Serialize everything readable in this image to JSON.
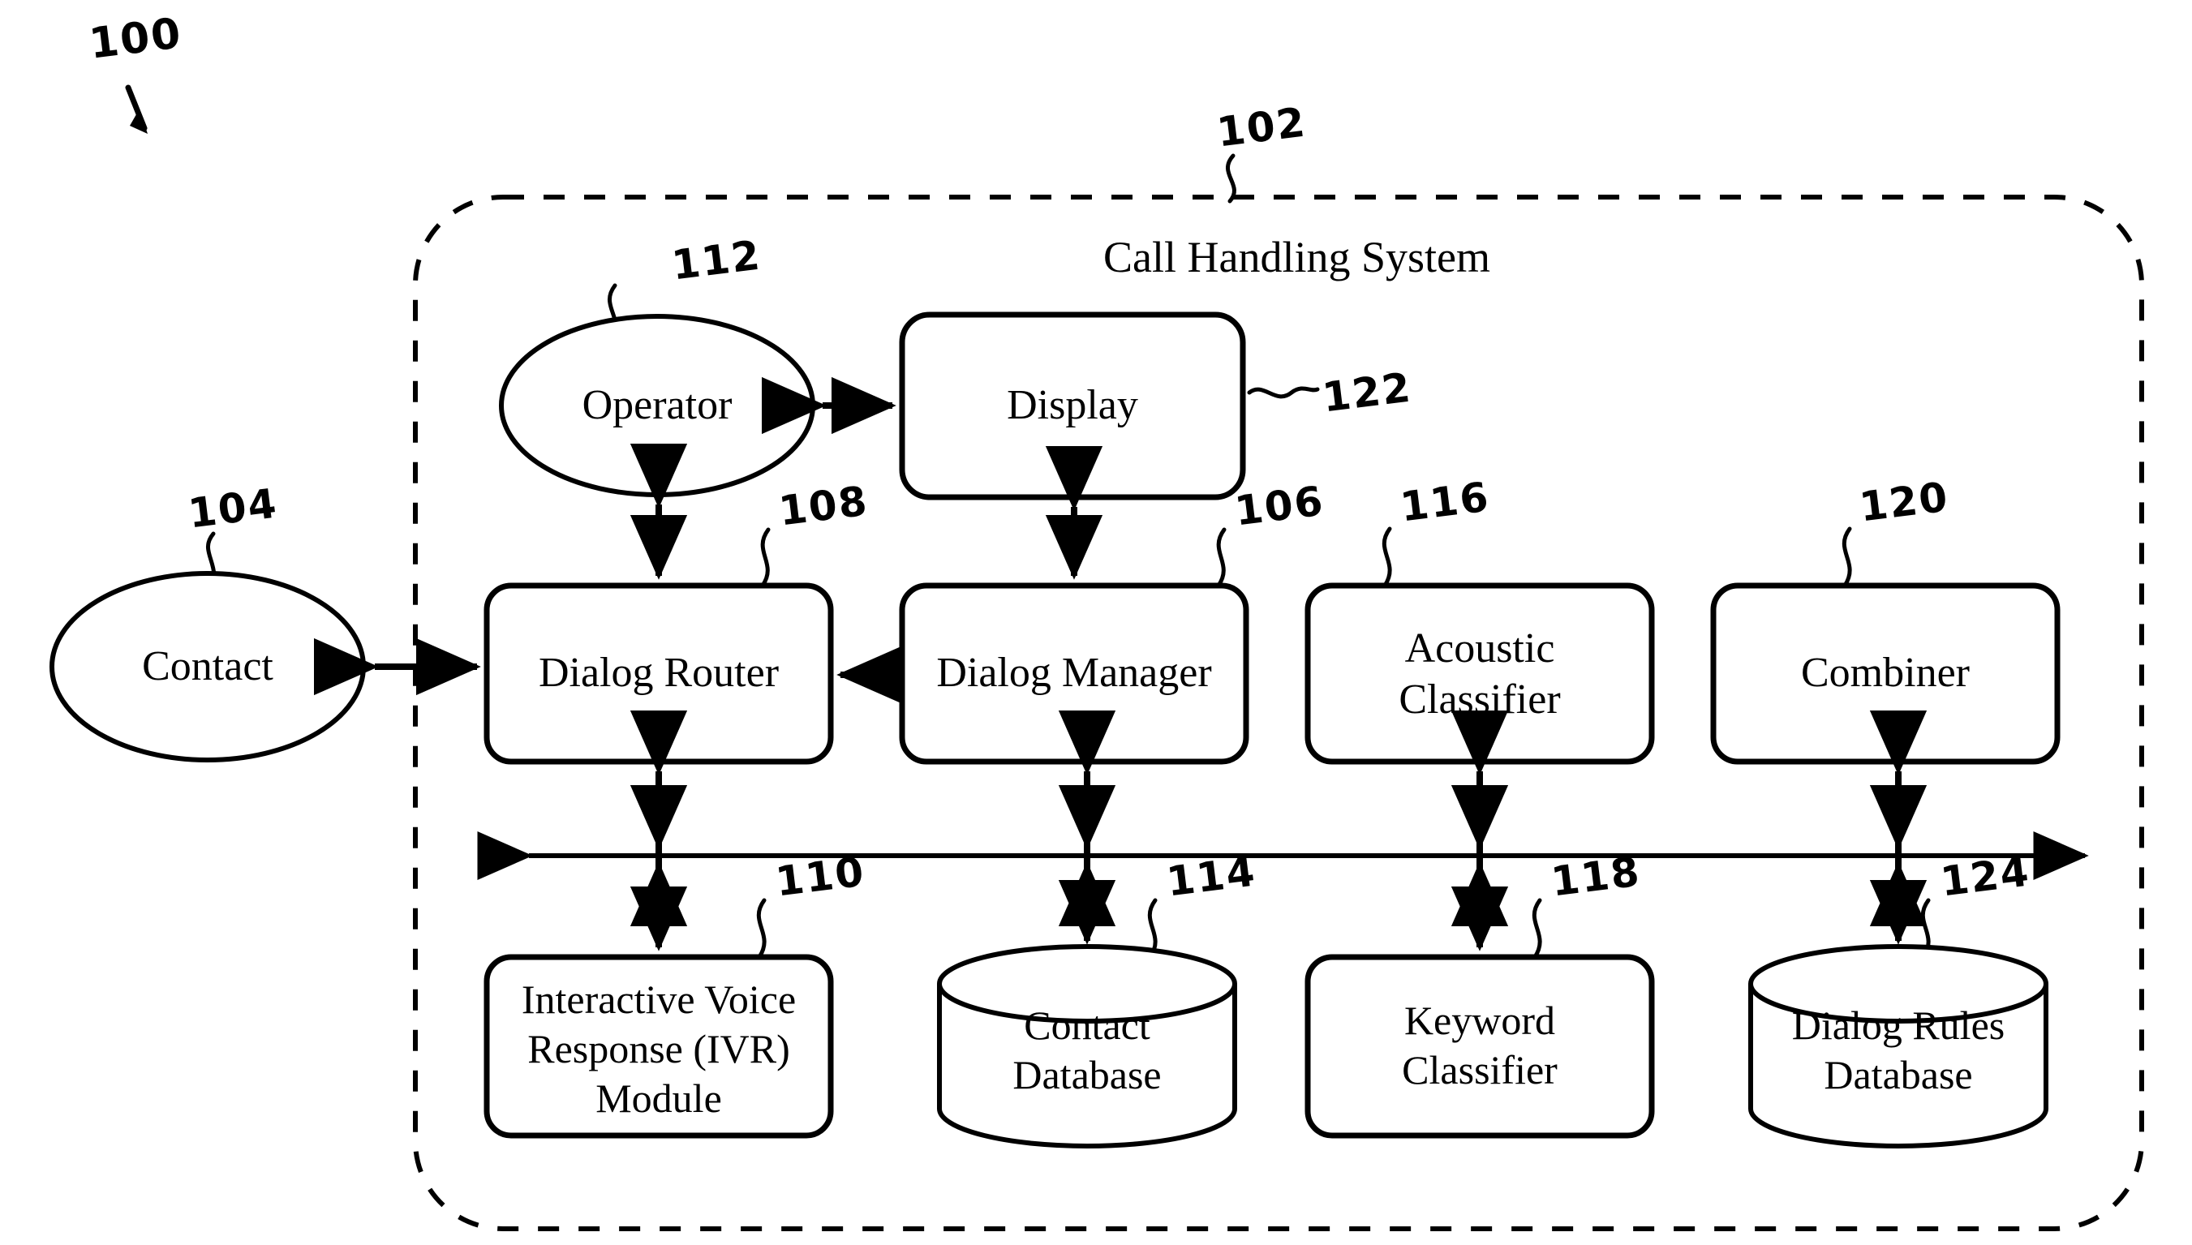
{
  "figure": {
    "figure_ref": "100",
    "system_ref": "102",
    "system_title": "Call Handling System"
  },
  "external": {
    "contact": {
      "label": "Contact",
      "ref": "104"
    }
  },
  "nodes": [
    {
      "id": "operator",
      "label": "Operator",
      "ref": "112",
      "shape": "ellipse"
    },
    {
      "id": "display",
      "label": "Display",
      "ref": "122",
      "shape": "rounded-rect"
    },
    {
      "id": "dialog-router",
      "label": "Dialog Router",
      "ref": "108",
      "shape": "rounded-rect"
    },
    {
      "id": "dialog-manager",
      "label": "Dialog Manager",
      "ref": "106",
      "shape": "rounded-rect"
    },
    {
      "id": "acoustic-classifier",
      "label": "Acoustic\nClassifier",
      "ref": "116",
      "shape": "rounded-rect"
    },
    {
      "id": "combiner",
      "label": "Combiner",
      "ref": "120",
      "shape": "rounded-rect"
    },
    {
      "id": "ivr-module",
      "label": "Interactive Voice\nResponse (IVR)\nModule",
      "ref": "110",
      "shape": "rounded-rect"
    },
    {
      "id": "contact-database",
      "label": "Contact\nDatabase",
      "ref": "114",
      "shape": "cylinder"
    },
    {
      "id": "keyword-classifier",
      "label": "Keyword\nClassifier",
      "ref": "118",
      "shape": "rounded-rect"
    },
    {
      "id": "dialog-rules-database",
      "label": "Dialog Rules\nDatabase",
      "ref": "124",
      "shape": "cylinder"
    }
  ],
  "colors": {
    "stroke": "#000000",
    "background": "#ffffff"
  }
}
